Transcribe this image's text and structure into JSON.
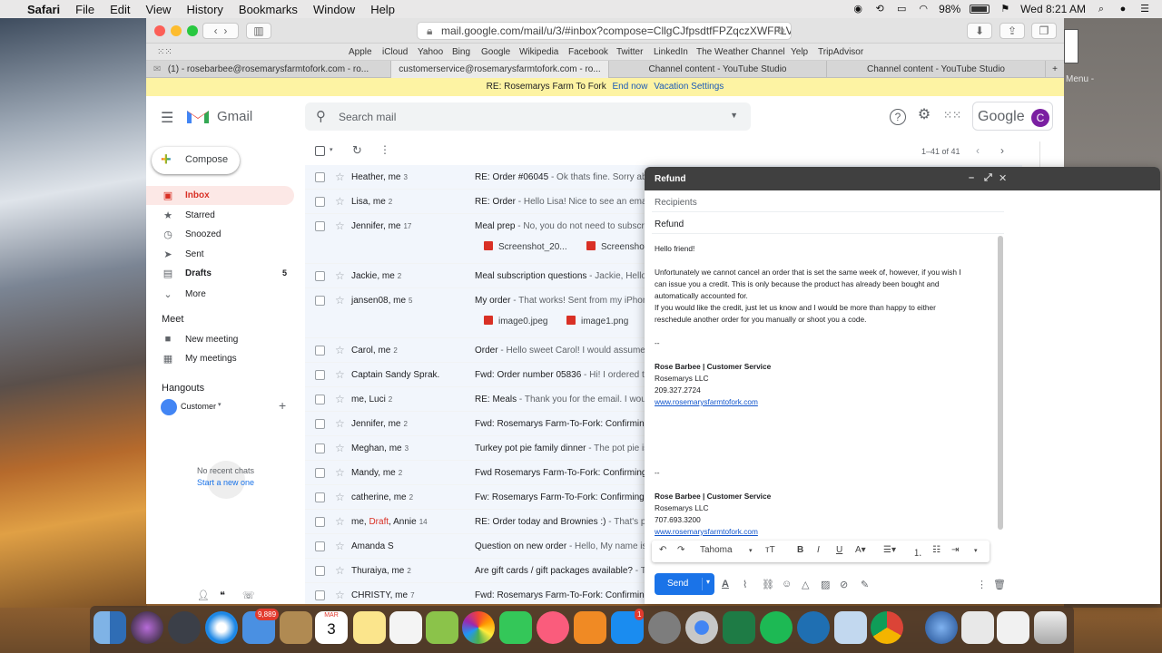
{
  "menubar": {
    "app": "Safari",
    "items": [
      "File",
      "Edit",
      "View",
      "History",
      "Bookmarks",
      "Window",
      "Help"
    ],
    "battery": "98%",
    "clock": "Wed 8:21 AM"
  },
  "safari": {
    "url": "mail.google.com/mail/u/3/#inbox?compose=CllgCJfpsdtfFPZqczXWFFLVPxW...",
    "favorites": [
      "Apple",
      "iCloud",
      "Yahoo",
      "Bing",
      "Google",
      "Wikipedia",
      "Facebook",
      "Twitter",
      "LinkedIn",
      "The Weather Channel",
      "Yelp",
      "TripAdvisor"
    ],
    "tabs": [
      "(1) - rosebarbee@rosemarysfarmtofork.com - ro...",
      "customerservice@rosemarysfarmtofork.com - ro...",
      "Channel content - YouTube Studio",
      "Channel content - YouTube Studio"
    ]
  },
  "banner": {
    "text": "RE: Rosemarys Farm To Fork",
    "end_now": "End now",
    "vacation": "Vacation Settings"
  },
  "gmail": {
    "product": "Gmail",
    "search_placeholder": "Search mail",
    "google_label": "Google",
    "avatar_letter": "C",
    "compose_label": "Compose",
    "nav": [
      {
        "label": "Inbox",
        "count": ""
      },
      {
        "label": "Starred",
        "count": ""
      },
      {
        "label": "Snoozed",
        "count": ""
      },
      {
        "label": "Sent",
        "count": ""
      },
      {
        "label": "Drafts",
        "count": "5"
      },
      {
        "label": "More",
        "count": ""
      }
    ],
    "meet": {
      "heading": "Meet",
      "new_meeting": "New meeting",
      "my_meetings": "My meetings"
    },
    "hangouts": {
      "heading": "Hangouts",
      "user": "Customer",
      "no_chats": "No recent chats",
      "start_new": "Start a new one"
    },
    "pager": "1–41 of 41",
    "emails": [
      {
        "sender": "Heather, me",
        "count": "3",
        "subject": "RE: Order #06045",
        "snippet": " - Ok thats fine. Sorry abo"
      },
      {
        "sender": "Lisa, me",
        "count": "2",
        "subject": "RE: Order",
        "snippet": " - Hello Lisa! Nice to see an email"
      },
      {
        "sender": "Jennifer, me",
        "count": "17",
        "subject": "Meal prep",
        "snippet": " - No, you do not need to subscrib"
      },
      {
        "sender": "Jackie, me",
        "count": "2",
        "subject": "Meal subscription questions",
        "snippet": " - Jackie, Hello"
      },
      {
        "sender": "jansen08, me",
        "count": "5",
        "subject": "My order",
        "snippet": " - That works! Sent from my iPhone"
      },
      {
        "sender": "Carol, me",
        "count": "2",
        "subject": "Order",
        "snippet": " - Hello sweet Carol! I would assume t"
      },
      {
        "sender": "Captain Sandy Sprak.",
        "count": "",
        "subject": "Fwd: Order number 05836",
        "snippet": " - Hi! I ordered th"
      },
      {
        "sender": "me, Luci",
        "count": "2",
        "subject": "RE: Meals",
        "snippet": " - Thank you for the email. I would"
      },
      {
        "sender": "Jennifer, me",
        "count": "2",
        "subject": "Fwd: Rosemarys Farm-To-Fork: Confirming",
        "snippet": ""
      },
      {
        "sender": "Meghan, me",
        "count": "3",
        "subject": "Turkey pot pie family dinner",
        "snippet": " - The pot pie is"
      },
      {
        "sender": "Mandy, me",
        "count": "2",
        "subject": "Fwd Rosemarys Farm-To-Fork: Confirming y",
        "snippet": ""
      },
      {
        "sender": "catherine, me",
        "count": "2",
        "subject": "Fw: Rosemarys Farm-To-Fork: Confirming y",
        "snippet": ""
      },
      {
        "sender_prefix": "me, ",
        "draft": "Draft",
        "sender": ", Annie",
        "count": "14",
        "subject": "RE: Order today and Brownies :)",
        "snippet": " - That's per"
      },
      {
        "sender": "Amanda S",
        "count": "",
        "subject": "Question on new order",
        "snippet": " - Hello, My name is A"
      },
      {
        "sender": "Thuraiya, me",
        "count": "2",
        "subject": "Are gift cards / gift packages available?",
        "snippet": " - T"
      },
      {
        "sender": "CHRISTY, me",
        "count": "7",
        "subject": "Fwd: Rosemarys Farm-To-Fork: Confirming",
        "snippet": ""
      }
    ],
    "attachments": {
      "meal_prep": [
        "Screenshot_20...",
        "Screenshot"
      ],
      "my_order": [
        "image0.jpeg",
        "image1.png"
      ]
    }
  },
  "compose_window": {
    "title": "Refund",
    "recipients_placeholder": "Recipients",
    "subject": "Refund",
    "body": {
      "greeting": "Hello friend!",
      "p1a": "Unfortunately we cannot cancel an order that is set the same week of, however, if you wish I",
      "p1b": "can issue you a credit. This is only because the product has already been bought and",
      "p1c": "automatically accounted for.",
      "p2a": "If you would like the credit, just let us know and I would be more than happy to either",
      "p2b": "reschedule another order for you manually or shoot you a code.",
      "sep": "--",
      "sig1_name": "Rose Barbee | Customer Service",
      "sig1_company": "Rosemarys LLC",
      "sig1_phone": "209.327.2724",
      "sig1_url": "www.rosemarysfarmtofork.com",
      "sep2": "--",
      "sig2_name": "Rose Barbee | Customer Service",
      "sig2_company": "Rosemarys LLC",
      "sig2_phone": "707.693.3200",
      "sig2_url": "www.rosemarysfarmtofork.com"
    },
    "font": "Tahoma",
    "send_label": "Send"
  },
  "dock": {
    "mail_badge": "9,889",
    "calendar_month": "MAR",
    "calendar_day": "3",
    "appstore_badge": "1"
  },
  "desktop": {
    "right_label": "Menu -"
  }
}
